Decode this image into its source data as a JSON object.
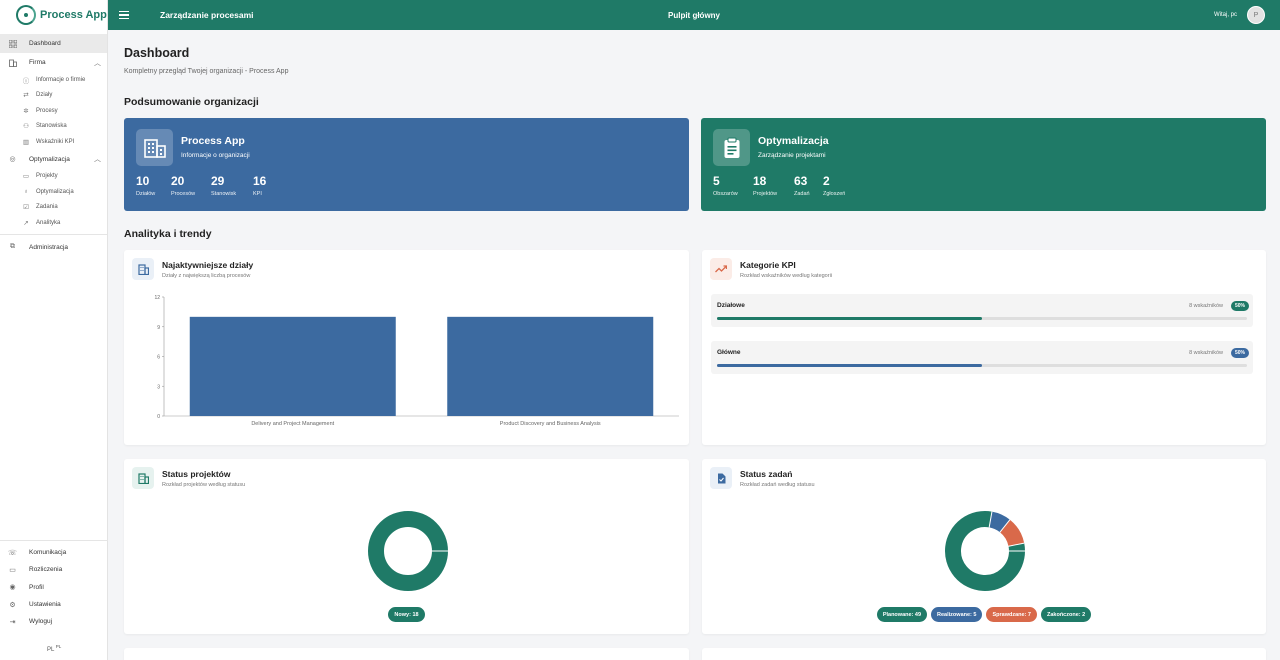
{
  "app": {
    "name": "Process App"
  },
  "topbar": {
    "section": "Zarządzanie procesami",
    "center": "Pulpit główny",
    "greeting": "Witaj, pc",
    "avatar_initial": "P"
  },
  "sidebar": {
    "dashboard": "Dashboard",
    "firma": {
      "label": "Firma",
      "items": [
        "Informacje o firmie",
        "Działy",
        "Procesy",
        "Stanowiska",
        "Wskaźniki KPI"
      ]
    },
    "optymalizacja": {
      "label": "Optymalizacja",
      "items": [
        "Projekty",
        "Optymalizacja",
        "Zadania",
        "Analityka"
      ]
    },
    "administracja": "Administracja",
    "bottom": [
      "Komunikacja",
      "Rozliczenia",
      "Profil",
      "Ustawienia",
      "Wyloguj"
    ],
    "lang": "PL",
    "lang_sup": "PL"
  },
  "page": {
    "title": "Dashboard",
    "subtitle": "Kompletny przegląd Twojej organizacji - Process App",
    "summary_heading": "Podsumowanie organizacji",
    "analytics_heading": "Analityka i trendy"
  },
  "summary_cards": [
    {
      "title": "Process App",
      "subtitle": "Informacje o organizacji",
      "stats": [
        {
          "value": "10",
          "label": "Działów"
        },
        {
          "value": "20",
          "label": "Procesów"
        },
        {
          "value": "29",
          "label": "Stanowisk"
        },
        {
          "value": "16",
          "label": "KPI"
        }
      ]
    },
    {
      "title": "Optymalizacja",
      "subtitle": "Zarządzanie projektami",
      "stats": [
        {
          "value": "5",
          "label": "Obszarów"
        },
        {
          "value": "18",
          "label": "Projektów"
        },
        {
          "value": "63",
          "label": "Zadań"
        },
        {
          "value": "2",
          "label": "Zgłoszeń"
        }
      ]
    }
  ],
  "cards": {
    "departments": {
      "title": "Najaktywniejsze działy",
      "subtitle": "Działy z największą liczbą procesów"
    },
    "kpi": {
      "title": "Kategorie KPI",
      "subtitle": "Rozkład wskaźników według kategorii",
      "rows": [
        {
          "name": "Działowe",
          "count": "8 wskaźników",
          "percent": "50%",
          "fraction": 0.5,
          "color": "#1f7a67"
        },
        {
          "name": "Główne",
          "count": "8 wskaźników",
          "percent": "50%",
          "fraction": 0.5,
          "color": "#3c6aa0"
        }
      ]
    },
    "projects": {
      "title": "Status projektów",
      "subtitle": "Rozkład projektów według statusu",
      "segments": [
        {
          "value": 18,
          "color": "#1f7a67"
        }
      ],
      "badges": [
        {
          "label": "Nowy: 18",
          "color": "#1f7a67"
        }
      ]
    },
    "tasks": {
      "title": "Status zadań",
      "subtitle": "Rozkład zadań według statusu",
      "segments": [
        {
          "value": 49,
          "color": "#1f7a67"
        },
        {
          "value": 5,
          "color": "#3c6aa0"
        },
        {
          "value": 7,
          "color": "#d9694a"
        },
        {
          "value": 2,
          "color": "#1f7a67"
        }
      ],
      "badges": [
        {
          "label": "Planowane: 49",
          "color": "#1f7a67"
        },
        {
          "label": "Realizowane: 5",
          "color": "#3c6aa0"
        },
        {
          "label": "Sprawdzane: 7",
          "color": "#d9694a"
        },
        {
          "label": "Zakończone: 2",
          "color": "#1f7a67"
        }
      ]
    }
  },
  "chart_data": {
    "type": "bar",
    "categories": [
      "Delivery and Project Management",
      "Product Discovery and Business Analysis"
    ],
    "values": [
      10,
      10
    ],
    "ylim": [
      0,
      12
    ],
    "yticks": [
      "0",
      "3",
      "6",
      "9",
      "12"
    ],
    "bar_color": "#3c6aa0",
    "grid": false
  },
  "colors": {
    "primary": "#1f7a67",
    "blue": "#3c6aa0",
    "orange": "#d9694a"
  }
}
